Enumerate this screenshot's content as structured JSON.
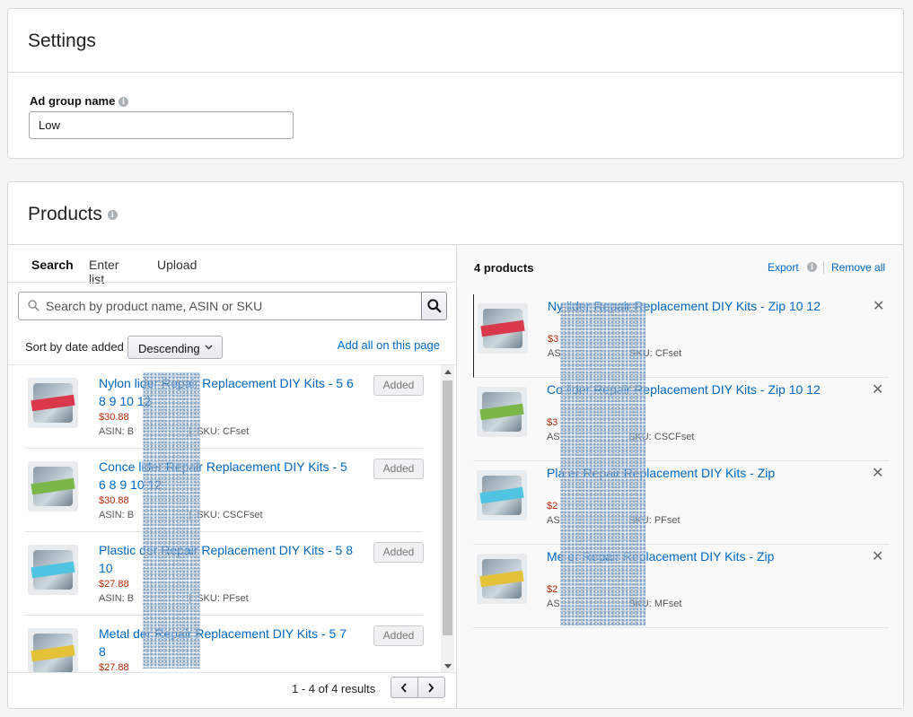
{
  "settings": {
    "title": "Settings",
    "ad_group_label": "Ad group name",
    "ad_group_value": "Low"
  },
  "products": {
    "title": "Products",
    "tabs": [
      {
        "label": "Search",
        "active": true
      },
      {
        "label": "Enter list",
        "active": false
      },
      {
        "label": "Upload",
        "active": false
      }
    ],
    "search": {
      "placeholder": "Search by product name, ASIN or SKU"
    },
    "sort": {
      "label": "Sort by date added",
      "selected": "Descending"
    },
    "add_all_label": "Add all on this page",
    "results_text": "1 - 4 of 4 results",
    "search_results": [
      {
        "title": "Nylon Zipper Slider Repair Replacement DIY Kits - Zipper 3 5 6 8 9 10 12",
        "title_visible": "Nylon          lider Repair Replacement DIY Kits -           5 6 8 9 10 12",
        "price": "$30.88",
        "asin": "ASIN: B",
        "sku": "SKU: CFset",
        "button": "Added",
        "color": "#d9394a"
      },
      {
        "title": "Concealed Zipper Slider Repair Replacement DIY Kits - 5 6 8 9 10 12",
        "title_visible": "Conce          lider Repair Replacement DIY Kits -           5 6 8 9 10 12",
        "price": "$30.88",
        "asin": "ASIN: B",
        "sku": "SKU: CSCFset",
        "button": "Added",
        "color": "#7ab648"
      },
      {
        "title": "Plastic Zipper Slider Repair Replacement DIY Kits - 5 8 10",
        "title_visible": "Plastic          der Repair Replacement DIY Kits -           5 8 10",
        "price": "$27.88",
        "asin": "ASIN: B",
        "sku": "SKU: PFset",
        "button": "Added",
        "color": "#4fc3e0"
      },
      {
        "title": "Metal Zipper Slider Repair Replacement DIY Kits - 5 7 8",
        "title_visible": "Metal          der Repair Replacement DIY Kits -           5 7 8",
        "price": "$27.88",
        "asin": "",
        "sku": "",
        "button": "Added",
        "color": "#e3c23a"
      }
    ],
    "selected_count": "4 products",
    "export_label": "Export",
    "remove_all_label": "Remove all",
    "selected": [
      {
        "title_visible": "Ny                 lider Repair Replacement DIY Kits - Zip                 10 12",
        "price": "$3",
        "asin": "AS",
        "sku": "SKU: CFset",
        "color": "#d9394a"
      },
      {
        "title_visible": "Co                  lider Repair Replacement DIY Kits - Zip                 10 12",
        "price": "$3",
        "asin": "AS",
        "sku": "SKU: CSCFset",
        "color": "#7ab648"
      },
      {
        "title_visible": "Pla                 er Repair Replacement DIY Kits - Zip",
        "price": "$2",
        "asin": "AS",
        "sku": "SKU: PFset",
        "color": "#4fc3e0"
      },
      {
        "title_visible": "Me                 er Repair Replacement DIY Kits - Zip",
        "price": "$2",
        "asin": "AS",
        "sku": "SKU: MFset",
        "color": "#e3c23a"
      }
    ]
  },
  "icons": {
    "info": "info-icon",
    "search": "search-icon",
    "chevron": "chevron-down-icon",
    "close": "close-icon"
  },
  "colors": {
    "link": "#0066c0",
    "price": "#b12704",
    "tab_underline": "#1e6f94"
  }
}
